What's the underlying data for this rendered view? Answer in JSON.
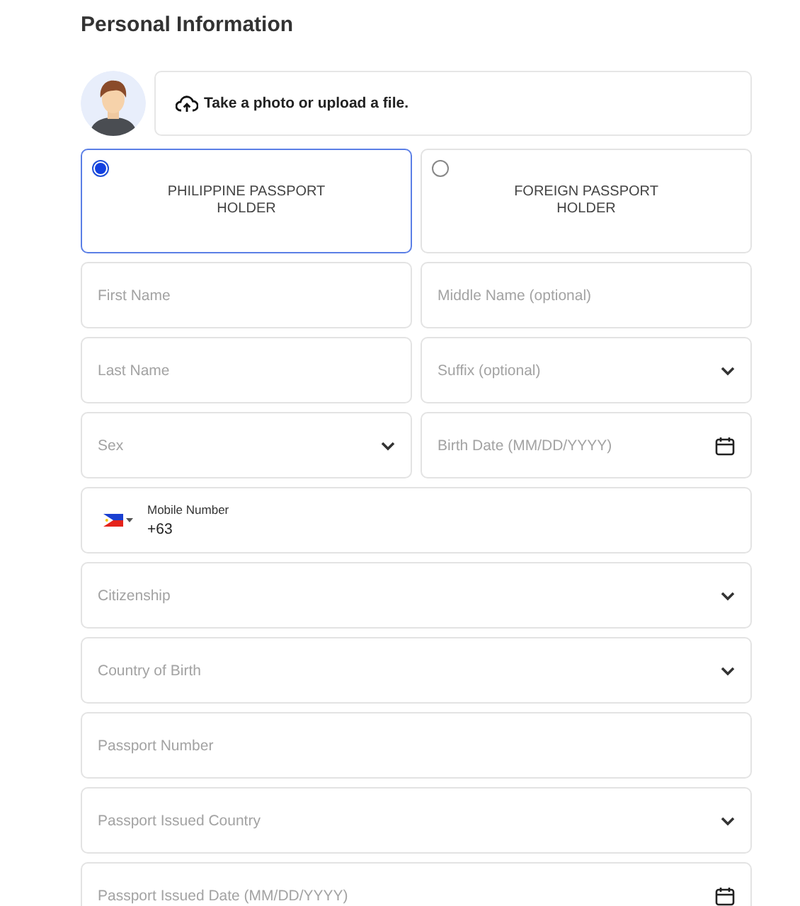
{
  "title": "Personal Information",
  "upload": {
    "label": "Take a photo or upload a file."
  },
  "holder_options": [
    {
      "label": "PHILIPPINE PASSPORT HOLDER",
      "selected": true
    },
    {
      "label": "FOREIGN PASSPORT HOLDER",
      "selected": false
    }
  ],
  "rows": [
    {
      "fields": [
        {
          "kind": "text",
          "placeholder": "First Name"
        },
        {
          "kind": "text",
          "placeholder": "Middle Name (optional)"
        }
      ]
    },
    {
      "fields": [
        {
          "kind": "text",
          "placeholder": "Last Name"
        },
        {
          "kind": "select",
          "placeholder": "Suffix (optional)"
        }
      ]
    },
    {
      "fields": [
        {
          "kind": "select",
          "placeholder": "Sex"
        },
        {
          "kind": "date",
          "placeholder": "Birth Date (MM/DD/YYYY)"
        }
      ]
    },
    {
      "fields": [
        {
          "kind": "phone",
          "label": "Mobile Number",
          "value": "+63"
        }
      ]
    },
    {
      "fields": [
        {
          "kind": "select",
          "placeholder": "Citizenship"
        }
      ]
    },
    {
      "fields": [
        {
          "kind": "select",
          "placeholder": "Country of Birth"
        }
      ]
    },
    {
      "fields": [
        {
          "kind": "text",
          "placeholder": "Passport Number"
        }
      ]
    },
    {
      "fields": [
        {
          "kind": "select",
          "placeholder": "Passport Issued Country"
        }
      ]
    },
    {
      "fields": [
        {
          "kind": "date",
          "placeholder": "Passport Issued Date (MM/DD/YYYY)"
        }
      ]
    }
  ]
}
